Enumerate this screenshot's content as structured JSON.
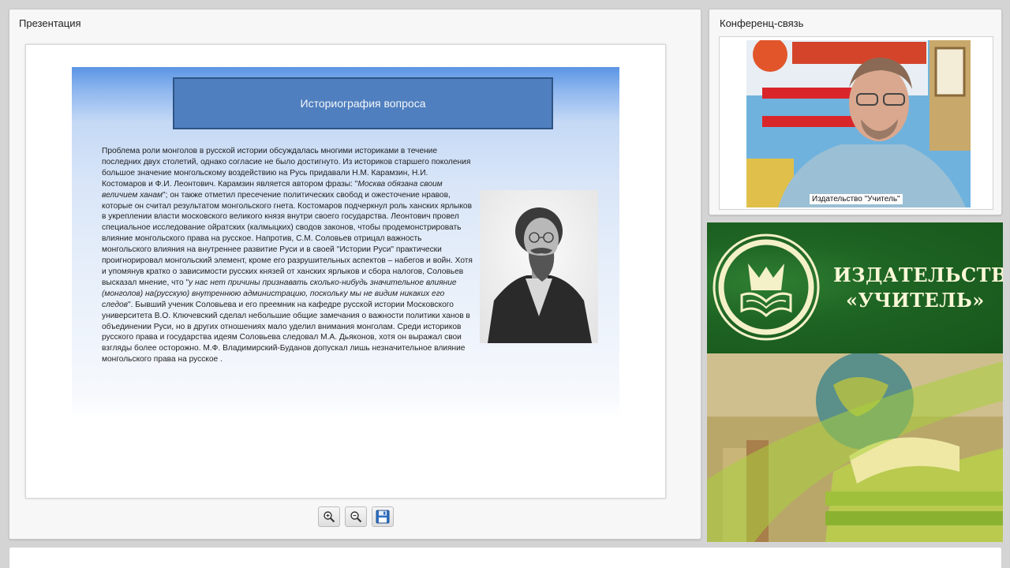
{
  "presentation": {
    "title": "Презентация",
    "slide": {
      "heading": "Историография вопроса",
      "body": {
        "p1": "Проблема роли монголов в русской истории обсуждалась многими историками в течение последних двух столетий, однако согласие не было достигнуто. Из историков старшего поколения большое значение монгольскому воздействию на Русь придавали Н.М. Карамзин, Н.И. Костомаров и Ф.И. Леонтович. Карамзин является автором фразы: \"",
        "quote1": "Москва обязана своим величием ханам",
        "p2": "\"; он также отметил пресечение политических свобод и ожесточение нравов, которые он считал результатом монгольского гнета. Костомаров подчеркнул роль ханских ярлыков в укреплении власти московского великого князя внутри своего государства. Леонтович провел специальное исследование ойратских (калмыцких) сводов законов, чтобы продемонстрировать влияние монгольского права на русское. Напротив, С.М. Соловьев отрицал важность монгольского влияния на внутреннее развитие Руси и в своей \"Истории Руси\" практически проигнорировал монгольский элемент, кроме его разрушительных аспектов – набегов и войн. Хотя и упомянув кратко о зависимости русских князей от ханских ярлыков и сбора налогов, Соловьев высказал мнение, что \"",
        "quote2": "у нас нет причины признавать сколько-нибудь значительное влияние (монголов) на(русскую) внутреннюю администрацию, поскольку мы не видим никаких его следов",
        "p3": "\". Бывший ученик Соловьева и его преемник на кафедре русской истории Московского университета В.О. Ключевский сделал небольшие общие замечания о важности политики ханов в объединении Руси, но в других отношениях мало уделил внимания монголам. Среди историков русского права и государства идеям Соловьева следовал М.А. Дьяконов, хотя он выражал свои взгляды более осторожно. М.Ф. Владимирский-Буданов допускал лишь незначительное влияние монгольского права на русское ."
      }
    },
    "toolbar": {
      "zoom_in_icon": "zoom-in-icon",
      "zoom_out_icon": "zoom-out-icon",
      "save_icon": "floppy-disk-icon"
    }
  },
  "conference": {
    "title": "Конференц-связь",
    "video_label": "Издательство \"Учитель\""
  },
  "banner": {
    "line1": "ИЗДАТЕЛЬСТВО",
    "line2": "«УЧИТЕЛЬ»",
    "colors": {
      "green": "#1e6423",
      "text": "#fbf8d8"
    }
  }
}
